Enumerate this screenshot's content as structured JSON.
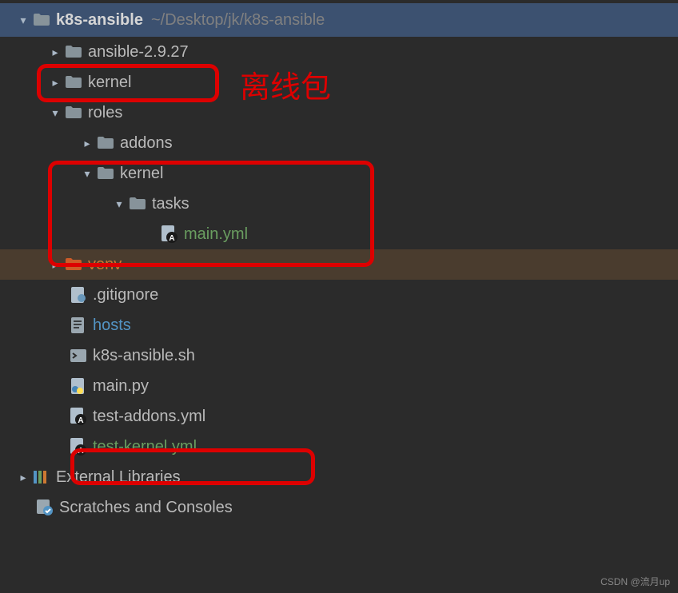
{
  "header": {
    "name": "k8s-ansible",
    "path": "~/Desktop/jk/k8s-ansible"
  },
  "tree": {
    "ansible": "ansible-2.9.27",
    "kernel": "kernel",
    "roles": "roles",
    "addons": "addons",
    "roles_kernel": "kernel",
    "tasks": "tasks",
    "main_yml": "main.yml",
    "venv": "venv",
    "gitignore": ".gitignore",
    "hosts": "hosts",
    "k8s_sh": "k8s-ansible.sh",
    "main_py": "main.py",
    "test_addons": "test-addons.yml",
    "test_kernel": "test-kernel.yml",
    "external": "External Libraries",
    "scratches": "Scratches and Consoles"
  },
  "annotation": "离线包",
  "watermark": "CSDN @流月up"
}
